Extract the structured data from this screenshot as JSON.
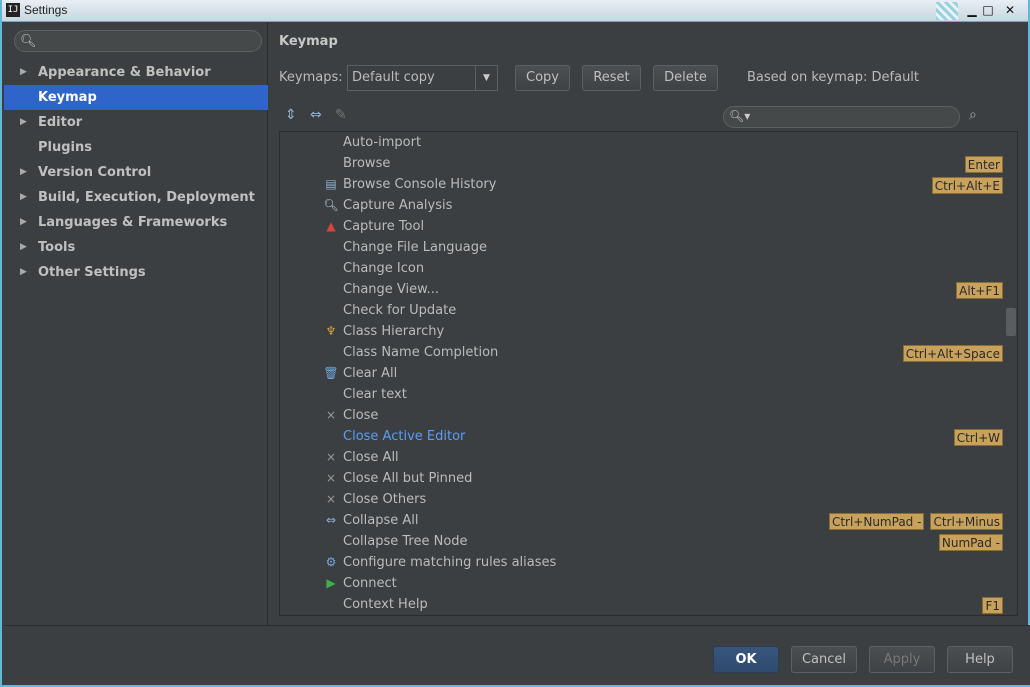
{
  "window": {
    "title": "Settings",
    "app_icon": "IJ"
  },
  "sidebar": {
    "search_placeholder": "",
    "items": [
      {
        "label": "Appearance & Behavior",
        "expandable": true,
        "selected": false
      },
      {
        "label": "Keymap",
        "expandable": false,
        "selected": true
      },
      {
        "label": "Editor",
        "expandable": true,
        "selected": false
      },
      {
        "label": "Plugins",
        "expandable": false,
        "selected": false
      },
      {
        "label": "Version Control",
        "expandable": true,
        "selected": false
      },
      {
        "label": "Build, Execution, Deployment",
        "expandable": true,
        "selected": false
      },
      {
        "label": "Languages & Frameworks",
        "expandable": true,
        "selected": false
      },
      {
        "label": "Tools",
        "expandable": true,
        "selected": false
      },
      {
        "label": "Other Settings",
        "expandable": true,
        "selected": false
      }
    ]
  },
  "main": {
    "title": "Keymap",
    "keymaps_label": "Keymaps:",
    "keymap_value": "Default copy",
    "copy_label": "Copy",
    "reset_label": "Reset",
    "delete_label": "Delete",
    "based_on": "Based on keymap: Default",
    "filter_placeholder": ""
  },
  "actions": [
    {
      "label": "Auto-import",
      "icon": "",
      "shortcuts": []
    },
    {
      "label": "Browse",
      "icon": "",
      "shortcuts": [
        "Enter"
      ]
    },
    {
      "label": "Browse Console History",
      "icon": "console-history-icon",
      "shortcuts": [
        "Ctrl+Alt+E"
      ]
    },
    {
      "label": "Capture Analysis",
      "icon": "magnifier-icon",
      "shortcuts": []
    },
    {
      "label": "Capture Tool",
      "icon": "warning-triangle-icon",
      "shortcuts": []
    },
    {
      "label": "Change File Language",
      "icon": "",
      "shortcuts": []
    },
    {
      "label": "Change Icon",
      "icon": "",
      "shortcuts": []
    },
    {
      "label": "Change View...",
      "icon": "",
      "shortcuts": [
        "Alt+F1"
      ]
    },
    {
      "label": "Check for Update",
      "icon": "",
      "shortcuts": []
    },
    {
      "label": "Class Hierarchy",
      "icon": "hierarchy-icon",
      "shortcuts": []
    },
    {
      "label": "Class Name Completion",
      "icon": "",
      "shortcuts": [
        "Ctrl+Alt+Space"
      ]
    },
    {
      "label": "Clear All",
      "icon": "trash-icon",
      "shortcuts": []
    },
    {
      "label": "Clear text",
      "icon": "",
      "shortcuts": []
    },
    {
      "label": "Close",
      "icon": "close-x-icon",
      "shortcuts": []
    },
    {
      "label": "Close Active Editor",
      "icon": "",
      "shortcuts": [
        "Ctrl+W"
      ],
      "highlight": true
    },
    {
      "label": "Close All",
      "icon": "close-x-icon",
      "shortcuts": []
    },
    {
      "label": "Close All but Pinned",
      "icon": "close-x-icon",
      "shortcuts": []
    },
    {
      "label": "Close Others",
      "icon": "close-x-icon",
      "shortcuts": []
    },
    {
      "label": "Collapse All",
      "icon": "collapse-all-icon",
      "shortcuts": [
        "Ctrl+NumPad -",
        "Ctrl+Minus"
      ]
    },
    {
      "label": "Collapse Tree Node",
      "icon": "",
      "shortcuts": [
        "NumPad -"
      ]
    },
    {
      "label": "Configure matching rules aliases",
      "icon": "gear-icon",
      "shortcuts": []
    },
    {
      "label": "Connect",
      "icon": "play-icon",
      "shortcuts": []
    },
    {
      "label": "Context Help",
      "icon": "",
      "shortcuts": [
        "F1"
      ]
    }
  ],
  "footer": {
    "ok_label": "OK",
    "cancel_label": "Cancel",
    "apply_label": "Apply",
    "help_label": "Help"
  },
  "colors": {
    "background": "#3c3f41",
    "selection": "#2f65ca",
    "shortcut_badge": "#c8a15b",
    "link": "#589df6",
    "primary_button": "#38557d"
  }
}
